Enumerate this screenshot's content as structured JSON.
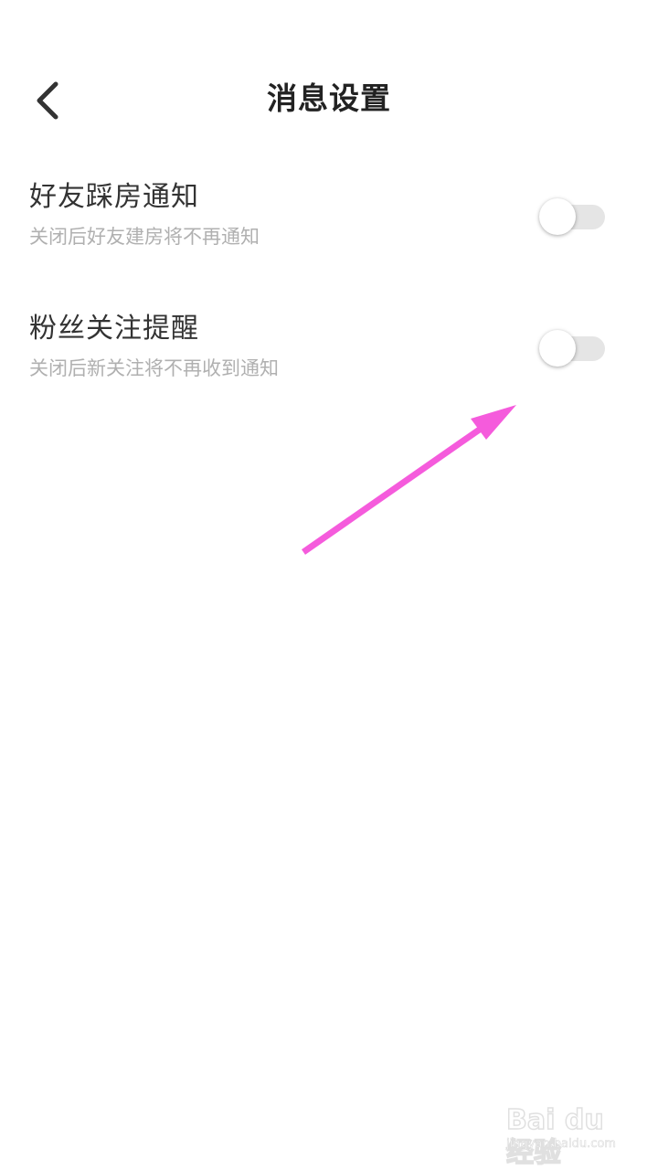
{
  "header": {
    "title": "消息设置",
    "back_icon": "chevron-left-icon"
  },
  "settings": [
    {
      "title": "好友踩房通知",
      "description": "关闭后好友建房将不再通知",
      "enabled": false
    },
    {
      "title": "粉丝关注提醒",
      "description": "关闭后新关注将不再收到通知",
      "enabled": false
    }
  ],
  "annotation": {
    "arrow_color": "#f55bdc",
    "icon": "arrow-annotation-icon"
  },
  "watermark": {
    "logo": "Bai du 经验",
    "url": "jingyan.baidu.com"
  },
  "colors": {
    "toggle_off_track": "#e5e5e5",
    "secondary_text": "#b0b0b0",
    "primary_text": "#333333"
  }
}
